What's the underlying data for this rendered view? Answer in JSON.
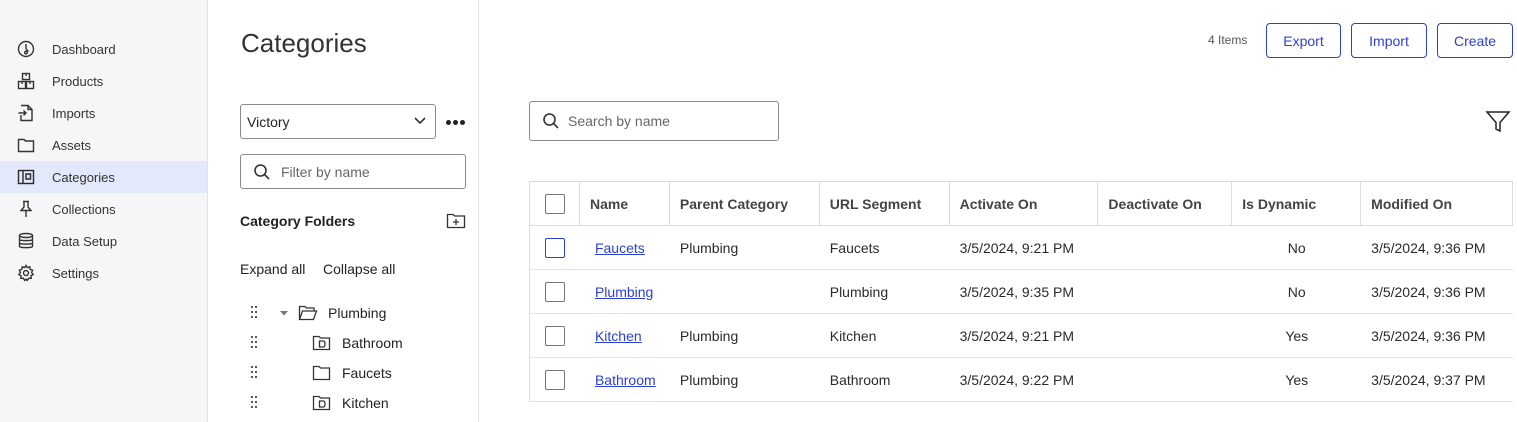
{
  "sidebar": {
    "items": [
      {
        "label": "Dashboard",
        "icon": "dashboard-icon",
        "active": false
      },
      {
        "label": "Products",
        "icon": "products-icon",
        "active": false
      },
      {
        "label": "Imports",
        "icon": "imports-icon",
        "active": false
      },
      {
        "label": "Assets",
        "icon": "folder-icon",
        "active": false
      },
      {
        "label": "Categories",
        "icon": "categories-icon",
        "active": true
      },
      {
        "label": "Collections",
        "icon": "pin-icon",
        "active": false
      },
      {
        "label": "Data Setup",
        "icon": "database-icon",
        "active": false
      },
      {
        "label": "Settings",
        "icon": "gear-icon",
        "active": false
      }
    ]
  },
  "tree_panel": {
    "title": "Categories",
    "catalog_selected": "Victory",
    "filter_placeholder": "Filter by name",
    "folders_heading": "Category Folders",
    "expand_all": "Expand all",
    "collapse_all": "Collapse all",
    "tree": [
      {
        "label": "Plumbing",
        "level": 0,
        "expanded": true,
        "icon": "folder-open-icon"
      },
      {
        "label": "Bathroom",
        "level": 1,
        "icon": "dynamic-folder-icon"
      },
      {
        "label": "Faucets",
        "level": 1,
        "icon": "folder-icon"
      },
      {
        "label": "Kitchen",
        "level": 1,
        "icon": "dynamic-folder-icon"
      }
    ]
  },
  "main": {
    "item_count": "4 Items",
    "buttons": {
      "export": "Export",
      "import": "Import",
      "create": "Create"
    },
    "search_placeholder": "Search by name",
    "columns": [
      "Name",
      "Parent Category",
      "URL Segment",
      "Activate On",
      "Deactivate On",
      "Is Dynamic",
      "Modified On"
    ],
    "rows": [
      {
        "name": "Faucets",
        "parent": "Plumbing",
        "url_segment": "Faucets",
        "activate_on": "3/5/2024, 9:21 PM",
        "deactivate_on": "",
        "is_dynamic": "No",
        "modified_on": "3/5/2024, 9:36 PM",
        "checkbox_focused": true
      },
      {
        "name": "Plumbing",
        "parent": "",
        "url_segment": "Plumbing",
        "activate_on": "3/5/2024, 9:35 PM",
        "deactivate_on": "",
        "is_dynamic": "No",
        "modified_on": "3/5/2024, 9:36 PM",
        "checkbox_focused": false
      },
      {
        "name": "Kitchen",
        "parent": "Plumbing",
        "url_segment": "Kitchen",
        "activate_on": "3/5/2024, 9:21 PM",
        "deactivate_on": "",
        "is_dynamic": "Yes",
        "modified_on": "3/5/2024, 9:36 PM",
        "checkbox_focused": false
      },
      {
        "name": "Bathroom",
        "parent": "Plumbing",
        "url_segment": "Bathroom",
        "activate_on": "3/5/2024, 9:22 PM",
        "deactivate_on": "",
        "is_dynamic": "Yes",
        "modified_on": "3/5/2024, 9:37 PM",
        "checkbox_focused": false
      }
    ]
  },
  "colors": {
    "accent": "#2b3fd0",
    "active_nav_bg": "#e3e8fb",
    "sidebar_bg": "#f6f6f6"
  }
}
